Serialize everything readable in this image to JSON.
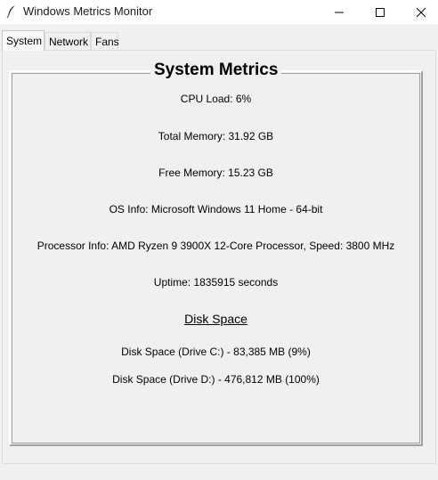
{
  "window": {
    "title": "Windows Metrics Monitor",
    "icon": "feather-icon",
    "controls": [
      "minimize-icon",
      "maximize-icon",
      "close-icon"
    ]
  },
  "tabs": [
    {
      "label": "System",
      "active": true
    },
    {
      "label": "Network",
      "active": false
    },
    {
      "label": "Fans",
      "active": false
    }
  ],
  "system": {
    "frame_title": "System Metrics",
    "cpu_load": "CPU Load: 6%",
    "total_memory": "Total Memory: 31.92 GB",
    "free_memory": "Free Memory: 15.23 GB",
    "os_info": "OS Info: Microsoft Windows 11 Home - 64-bit",
    "processor_info": "Processor Info: AMD Ryzen 9 3900X 12-Core Processor, Speed: 3800 MHz",
    "uptime": "Uptime: 1835915 seconds",
    "disk_heading": "Disk Space",
    "disk_c": "Disk Space (Drive C:) - 83,385 MB (9%)",
    "disk_d": "Disk Space (Drive D:) - 476,812 MB (100%)"
  }
}
